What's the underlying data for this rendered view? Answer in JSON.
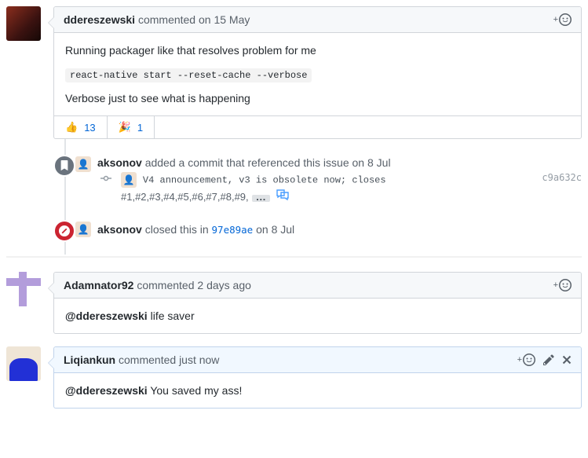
{
  "comments": [
    {
      "author": "ddereszewski",
      "action": "commented",
      "time": "on 15 May",
      "body_line1": "Running packager like that resolves problem for me",
      "code": "react-native start --reset-cache --verbose",
      "body_line3": "Verbose just to see what is happening",
      "reactions": [
        {
          "emoji": "👍",
          "count": "13"
        },
        {
          "emoji": "🎉",
          "count": "1"
        }
      ],
      "current": false
    },
    {
      "author": "Adamnator92",
      "action": "commented",
      "time": "2 days ago",
      "body_plain_prefix": "@ddereszewski",
      "body_plain_rest": " life saver",
      "current": false
    },
    {
      "author": "Liqiankun",
      "action": "commented",
      "time": "just now",
      "body_plain_prefix": "@ddereszewski",
      "body_plain_rest": " You saved my ass!",
      "current": true
    }
  ],
  "timeline": {
    "ref_event": {
      "author": "aksonov",
      "text": " added a commit that referenced this issue ",
      "time": "on 8 Jul",
      "commit_msg": "V4 announcement, v3 is obsolete now; closes",
      "commit_sha": "c9a632c",
      "refs": "#1,#2,#3,#4,#5,#6,#7,#8,#9,",
      "ellipsis": "…"
    },
    "close_event": {
      "author": "aksonov",
      "text": " closed this in ",
      "sha": "97e89ae",
      "time": " on 8 Jul"
    }
  },
  "icons": {
    "plus": "+",
    "smiley": "☺",
    "pencil": "✎",
    "x": "✕"
  }
}
